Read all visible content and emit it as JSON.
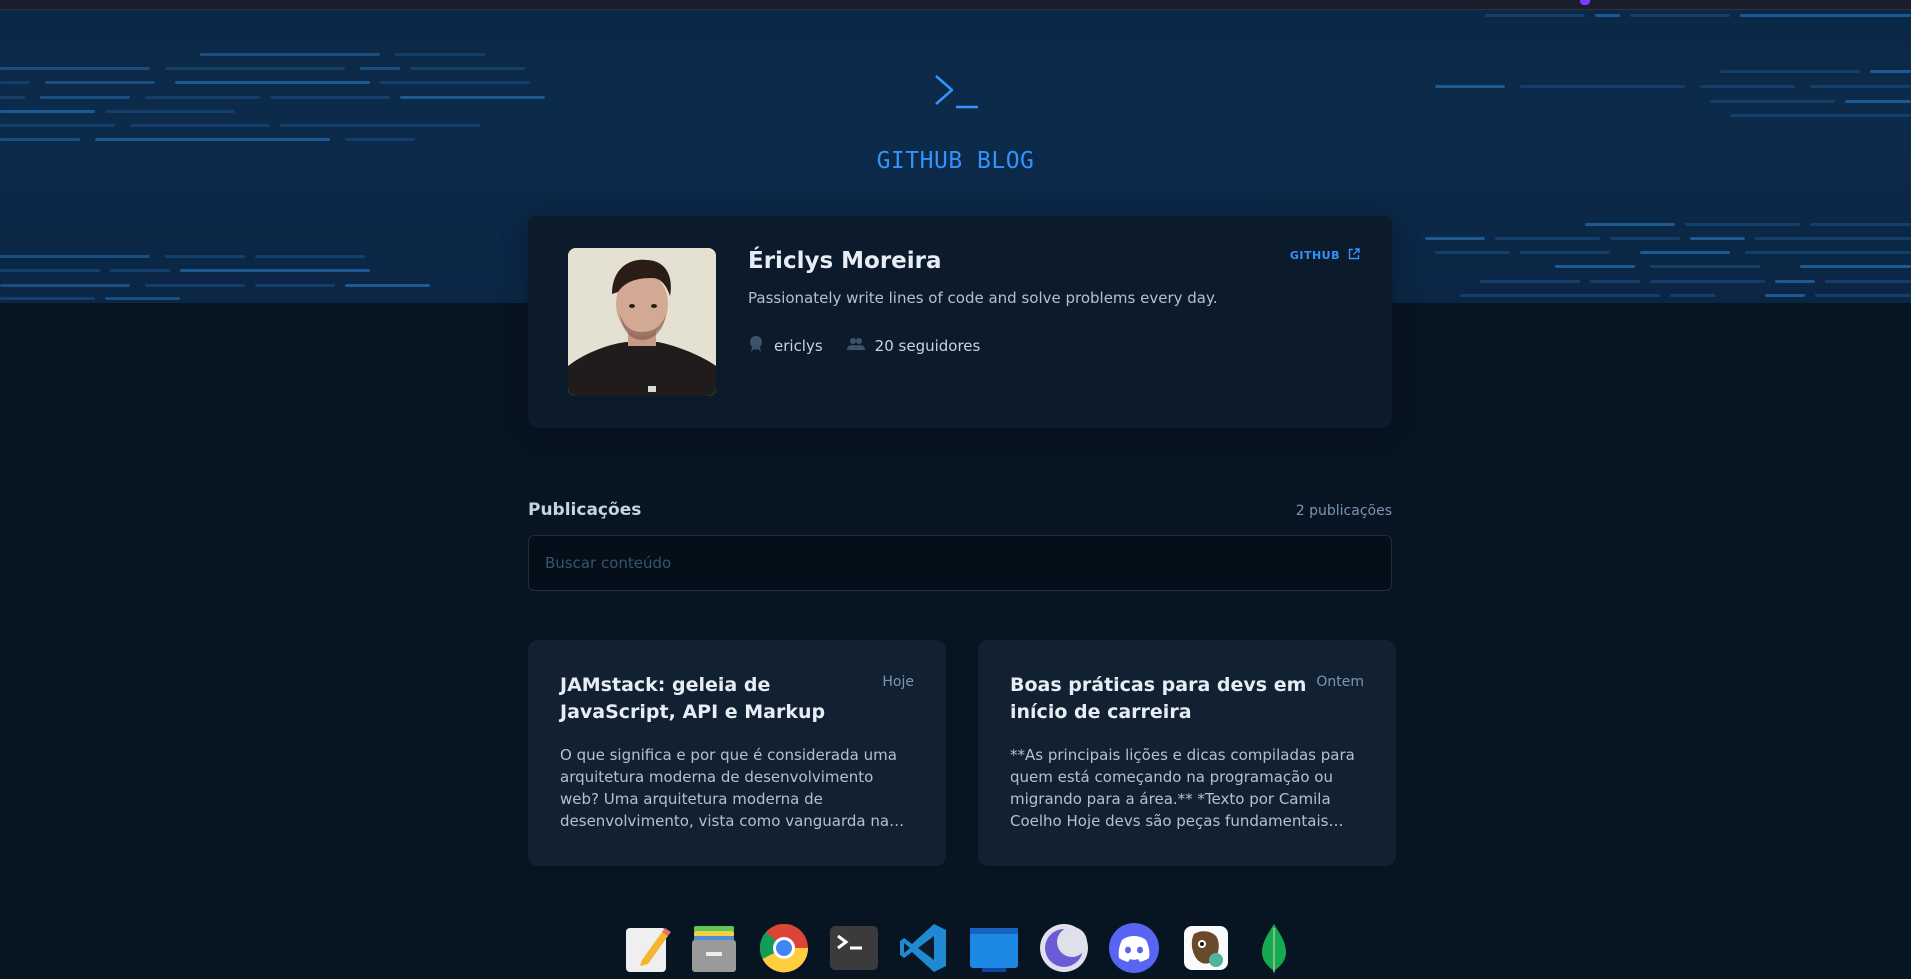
{
  "header": {
    "title": "GITHUB BLOG",
    "logo_icon": "terminal-prompt-icon",
    "accent": "#3294F8"
  },
  "profile": {
    "name": "Ériclys Moreira",
    "bio": "Passionately write lines of code and solve problems every day.",
    "github_link": "GITHUB",
    "username": "ericlys",
    "followers": "20 seguidores"
  },
  "publications": {
    "title": "Publicações",
    "count": "2 publicações",
    "search_placeholder": "Buscar conteúdo"
  },
  "posts": [
    {
      "title": "JAMstack: geleia de JavaScript, API e Markup",
      "date": "Hoje",
      "excerpt": "O que significa e por que é considerada uma arquitetura moderna de desenvolvimento web? Uma arquitetura moderna de desenvolvimento, vista como vanguarda na renascença de web..."
    },
    {
      "title": "Boas práticas para devs em início de carreira",
      "date": "Ontem",
      "excerpt": "**As principais lições e dicas compiladas para quem está começando na programação ou migrando para a área.** *Texto por Camila Coelho Hoje devs são peças fundamentais de..."
    }
  ],
  "dock": [
    {
      "name": "text-editor-icon"
    },
    {
      "name": "file-manager-icon"
    },
    {
      "name": "chrome-icon"
    },
    {
      "name": "terminal-icon"
    },
    {
      "name": "vscode-icon"
    },
    {
      "name": "desktop-icon"
    },
    {
      "name": "moon-app-icon"
    },
    {
      "name": "discord-icon"
    },
    {
      "name": "beekeeper-icon"
    },
    {
      "name": "mongodb-icon"
    }
  ]
}
